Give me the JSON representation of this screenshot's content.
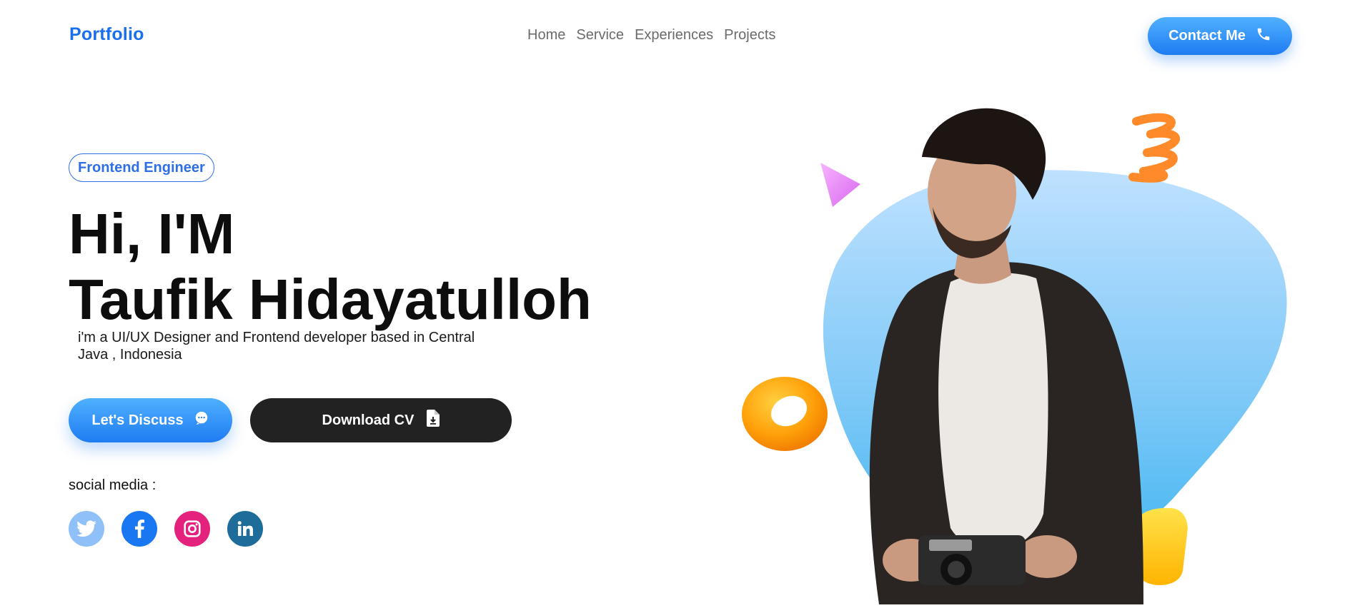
{
  "header": {
    "logo": "Portfolio",
    "nav": [
      "Home",
      "Service",
      "Experiences",
      "Projects"
    ],
    "contact_label": "Contact Me"
  },
  "hero": {
    "badge": "Frontend Engineer",
    "title_line1": "Hi, I'M",
    "title_line2": "Taufik Hidayatulloh",
    "description": "i'm a UI/UX Designer and Frontend developer based in Central Java , Indonesia",
    "discuss_label": "Let's Discuss",
    "cv_label": "Download CV",
    "social_label": "social media :"
  },
  "social": [
    {
      "name": "twitter",
      "color": "#8fc0f7"
    },
    {
      "name": "facebook",
      "color": "#1977f2"
    },
    {
      "name": "instagram",
      "color": "#e4217d"
    },
    {
      "name": "linkedin",
      "color": "#1d6c9a"
    }
  ],
  "colors": {
    "accent": "#1a6ef0",
    "dark_button": "#222222",
    "blob_top": "#bfe1ff",
    "blob_bottom": "#3db4f0"
  }
}
